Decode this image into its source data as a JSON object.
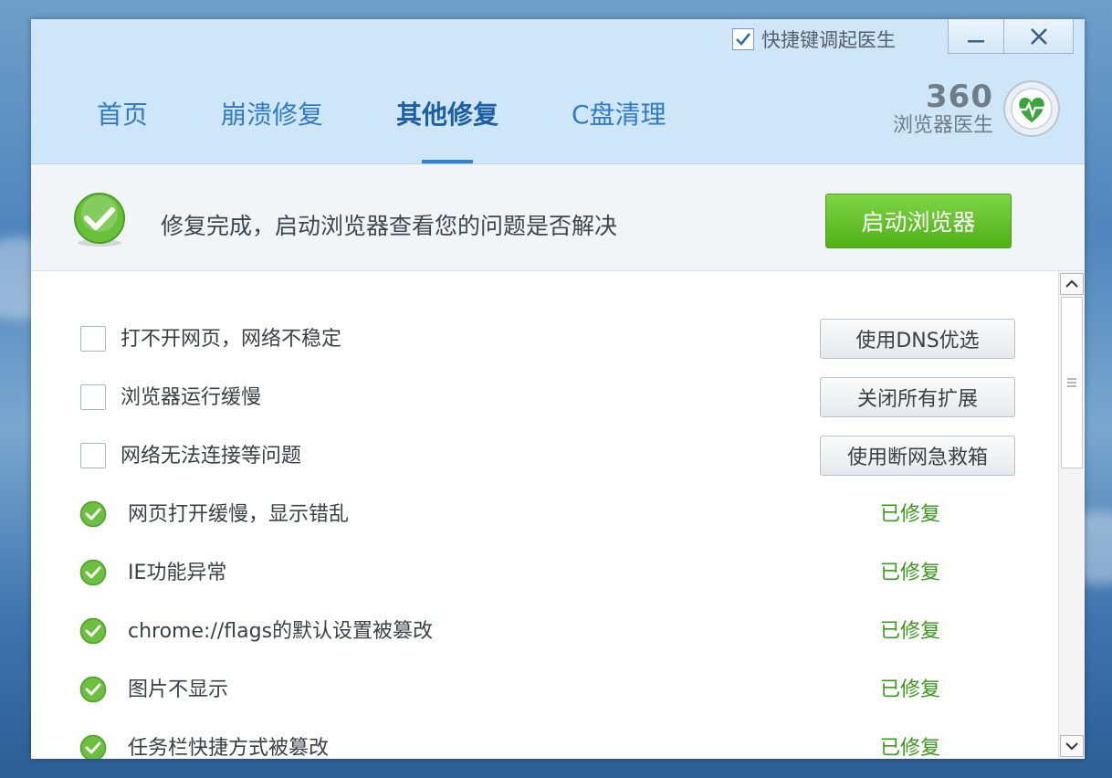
{
  "header": {
    "hotkey_label": "快捷键调起医生",
    "hotkey_checked": true,
    "tabs": [
      {
        "label": "首页",
        "active": false
      },
      {
        "label": "崩溃修复",
        "active": false
      },
      {
        "label": "其他修复",
        "active": true
      },
      {
        "label": "C盘清理",
        "active": false
      }
    ],
    "brand_number": "360",
    "brand_name": "浏览器医生"
  },
  "status": {
    "message": "修复完成，启动浏览器查看您的问题是否解决",
    "launch_button": "启动浏览器"
  },
  "items": [
    {
      "label": "打不开网页，网络不稳定",
      "action": "使用DNS优选",
      "fixed": false
    },
    {
      "label": "浏览器运行缓慢",
      "action": "关闭所有扩展",
      "fixed": false
    },
    {
      "label": "网络无法连接等问题",
      "action": "使用断网急救箱",
      "fixed": false
    },
    {
      "label": "网页打开缓慢，显示错乱",
      "status": "已修复",
      "fixed": true
    },
    {
      "label": "IE功能异常",
      "status": "已修复",
      "fixed": true
    },
    {
      "label": "chrome://flags的默认设置被篡改",
      "status": "已修复",
      "fixed": true
    },
    {
      "label": "图片不显示",
      "status": "已修复",
      "fixed": true
    },
    {
      "label": "任务栏快捷方式被篡改",
      "status": "已修复",
      "fixed": true
    }
  ],
  "colors": {
    "accent_blue": "#2e7bc9",
    "success_green": "#3a9a1a",
    "launch_green": "#5ab81f",
    "header_bg": "#cfe6f9"
  },
  "icons": {
    "minimize": "minimize-icon",
    "close": "close-icon",
    "status": "check-circle-icon",
    "logo": "heart-pulse-icon"
  }
}
